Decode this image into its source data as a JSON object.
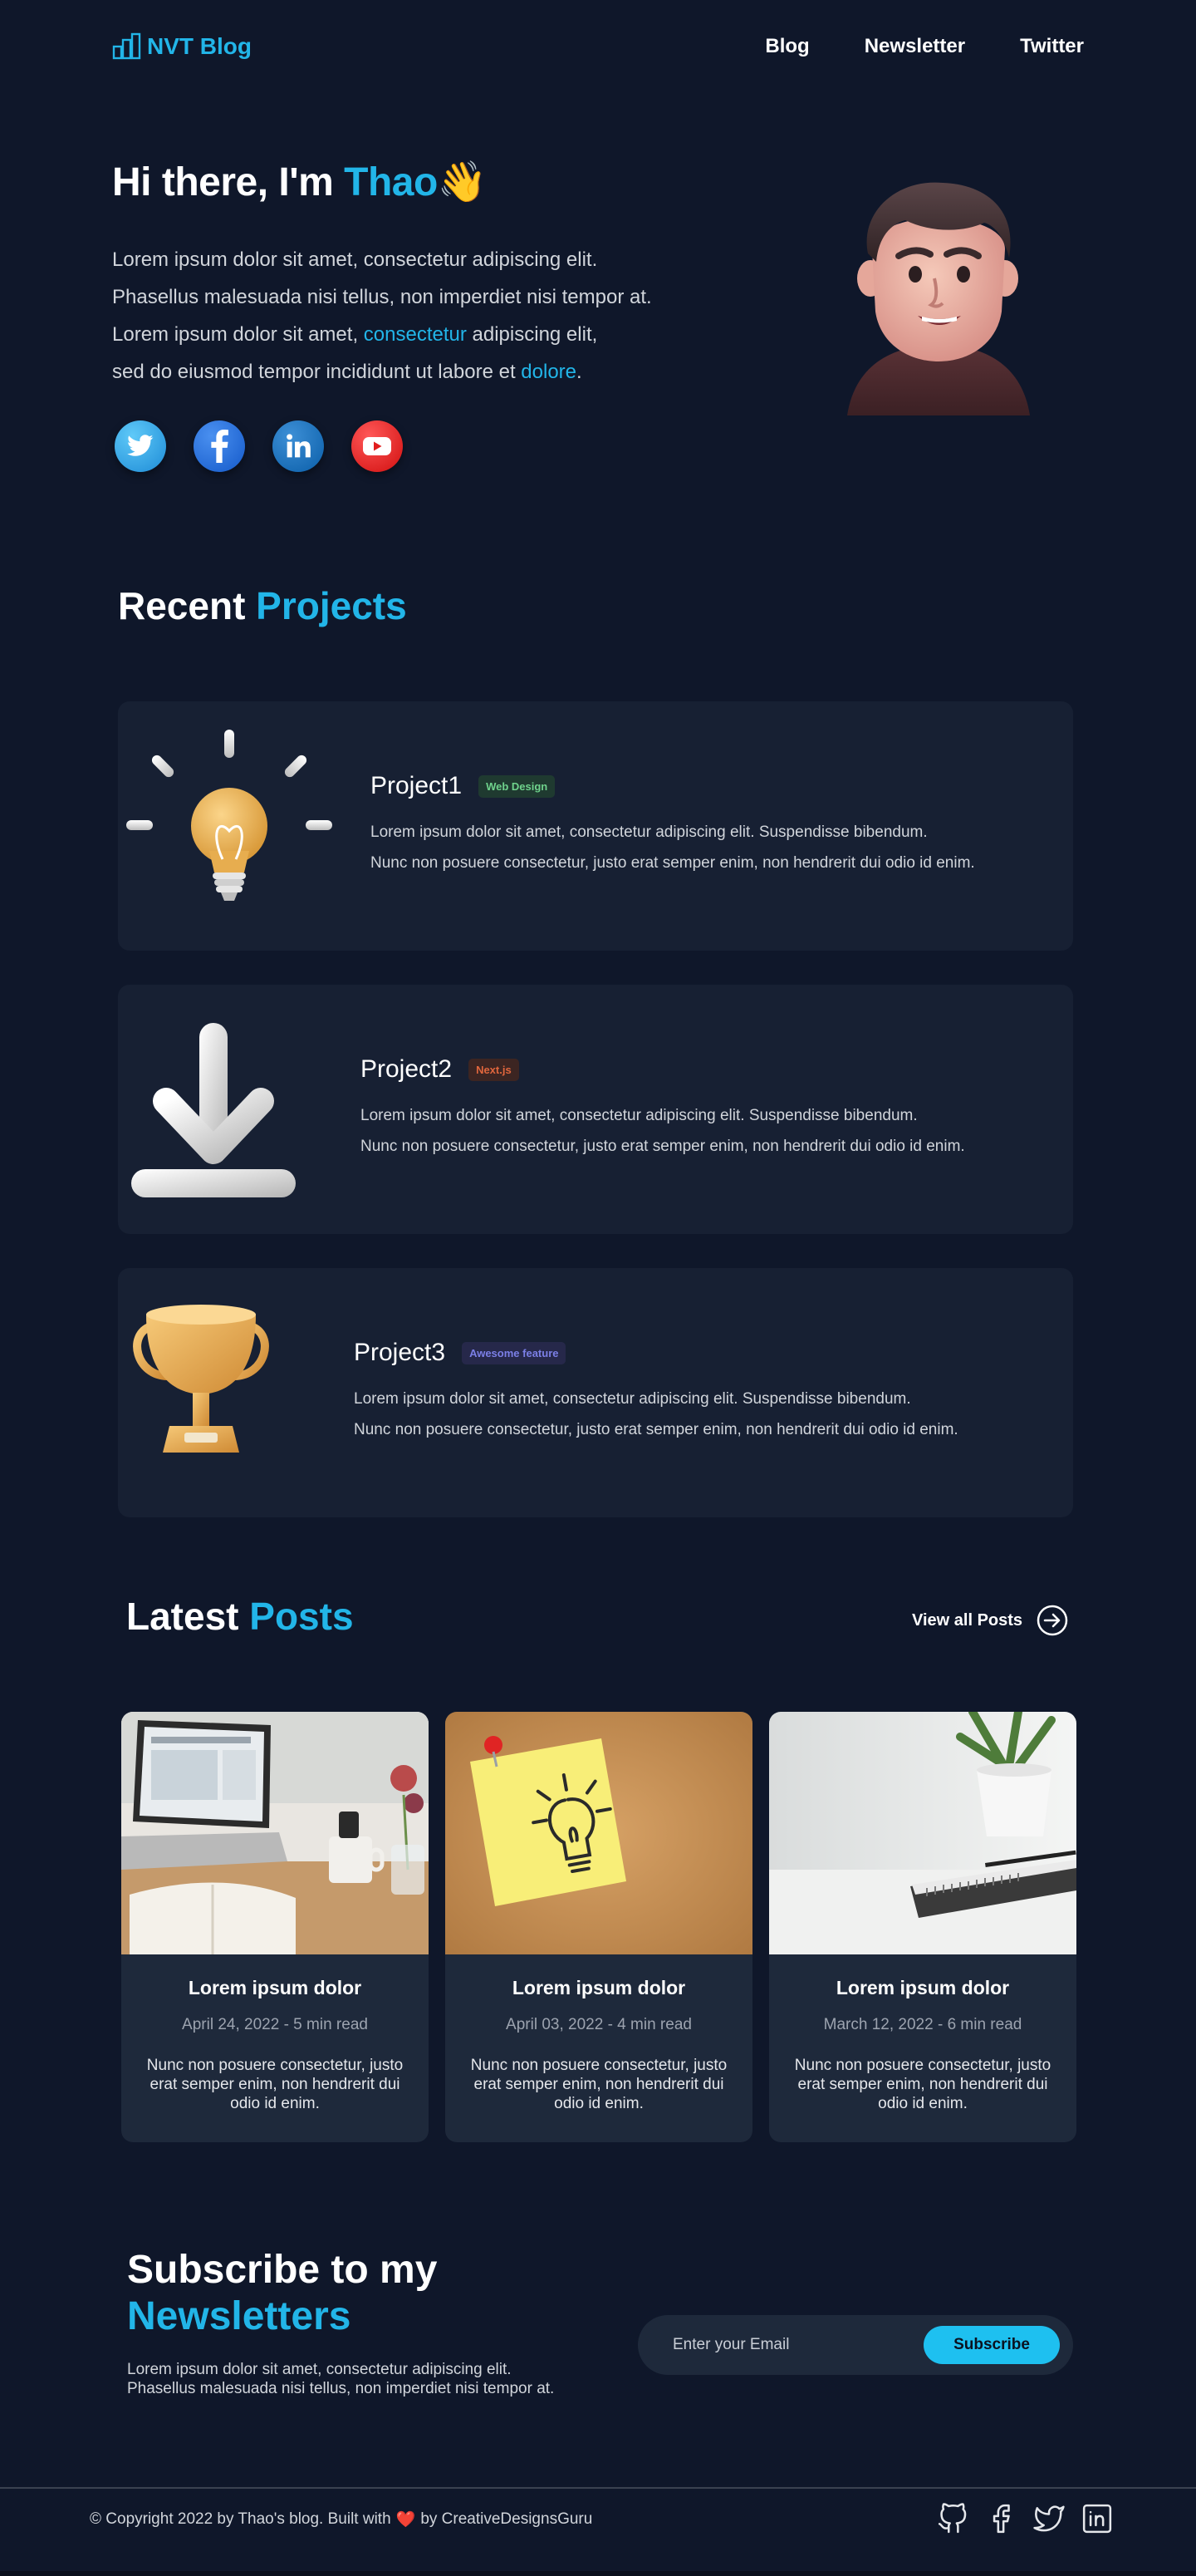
{
  "nav": {
    "logo_text": "NVT Blog",
    "links": [
      {
        "label": "Blog"
      },
      {
        "label": "Newsletter"
      },
      {
        "label": "Twitter"
      }
    ]
  },
  "hero": {
    "greeting": "Hi there, I'm ",
    "name": "Thao",
    "wave": "👋",
    "line1": "Lorem ipsum dolor sit amet, consectetur adipiscing elit.",
    "line2": "Phasellus malesuada nisi tellus, non imperdiet nisi tempor at.",
    "line3_pre": "Lorem ipsum dolor sit amet, ",
    "line3_link": "consectetur",
    "line3_post": " adipiscing elit,",
    "line4_pre": "sed do eiusmod tempor incididunt ut labore et ",
    "line4_link": "dolore",
    "line4_post": ".",
    "socials": [
      {
        "icon": "twitter-icon"
      },
      {
        "icon": "facebook-icon"
      },
      {
        "icon": "linkedin-icon"
      },
      {
        "icon": "youtube-icon"
      }
    ]
  },
  "projects": {
    "title_a": "Recent ",
    "title_b": "Projects",
    "items": [
      {
        "title": "Project1",
        "tag": "Web Design",
        "line1": "Lorem ipsum dolor sit amet, consectetur adipiscing elit. Suspendisse bibendum.",
        "line2": "Nunc non posuere consectetur, justo erat semper enim, non hendrerit dui odio id enim."
      },
      {
        "title": "Project2",
        "tag": "Next.js",
        "line1": "Lorem ipsum dolor sit amet, consectetur adipiscing elit. Suspendisse bibendum.",
        "line2": "Nunc non posuere consectetur, justo erat semper enim, non hendrerit dui odio id enim."
      },
      {
        "title": "Project3",
        "tag": "Awesome feature",
        "line1": "Lorem ipsum dolor sit amet, consectetur adipiscing elit. Suspendisse bibendum.",
        "line2": "Nunc non posuere consectetur, justo erat semper enim, non hendrerit dui odio id enim."
      }
    ]
  },
  "posts": {
    "title_a": "Latest ",
    "title_b": "Posts",
    "view_all": "View all Posts",
    "items": [
      {
        "title": "Lorem ipsum dolor",
        "meta": "April 24, 2022 - 5 min read",
        "text": "Nunc non posuere consectetur, justo erat semper enim, non hendrerit dui odio id enim."
      },
      {
        "title": "Lorem ipsum dolor",
        "meta": "April 03, 2022 - 4 min read",
        "text": "Nunc non posuere consectetur, justo erat semper enim, non hendrerit dui odio id enim."
      },
      {
        "title": "Lorem ipsum dolor",
        "meta": "March 12, 2022 - 6 min read",
        "text": "Nunc non posuere consectetur, justo erat semper enim, non hendrerit dui odio id enim."
      }
    ]
  },
  "subscribe": {
    "title_a": "Subscribe to my",
    "title_b": "Newsletters",
    "line1": "Lorem ipsum dolor sit amet, consectetur adipiscing elit.",
    "line2": "Phasellus malesuada nisi tellus, non imperdiet nisi tempor at.",
    "placeholder": "Enter your Email",
    "button": "Subscribe"
  },
  "footer": {
    "copy_pre": "© Copyright 2022 by Thao's blog. Built with",
    "heart": "❤️",
    "copy_post": "by CreativeDesignsGuru",
    "icons": [
      "github-icon",
      "facebook-icon",
      "twitter-icon",
      "linkedin-icon"
    ]
  },
  "colors": {
    "background": "#0f172a",
    "accent": "#22b5e8",
    "card": "#172033"
  }
}
